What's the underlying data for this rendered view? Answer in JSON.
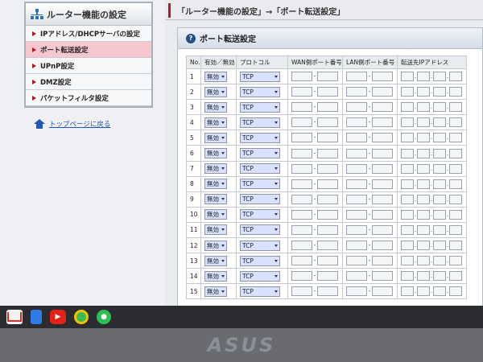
{
  "sidebar": {
    "title": "ルーター機能の設定",
    "items": [
      {
        "label": "IPアドレス/DHCPサーバの設定",
        "active": false
      },
      {
        "label": "ポート転送設定",
        "active": true
      },
      {
        "label": "UPnP設定",
        "active": false
      },
      {
        "label": "DMZ設定",
        "active": false
      },
      {
        "label": "パケットフィルタ設定",
        "active": false
      }
    ],
    "top_link": "トップページに戻る"
  },
  "breadcrumb": "「ルーター機能の設定」→「ポート転送設定」",
  "panel": {
    "title": "ポート転送設定",
    "help_icon": "?",
    "columns": [
      "No.",
      "有効／無効",
      "プロトコル",
      "WAN側ポート番号",
      "LAN側ポート番号",
      "転送先IPアドレス"
    ],
    "rows": [
      {
        "no": "1",
        "enabled": "無効",
        "protocol": "TCP"
      },
      {
        "no": "2",
        "enabled": "無効",
        "protocol": "TCP"
      },
      {
        "no": "3",
        "enabled": "無効",
        "protocol": "TCP"
      },
      {
        "no": "4",
        "enabled": "無効",
        "protocol": "TCP"
      },
      {
        "no": "5",
        "enabled": "無効",
        "protocol": "TCP"
      },
      {
        "no": "6",
        "enabled": "無効",
        "protocol": "TCP"
      },
      {
        "no": "7",
        "enabled": "無効",
        "protocol": "TCP"
      },
      {
        "no": "8",
        "enabled": "無効",
        "protocol": "TCP"
      },
      {
        "no": "9",
        "enabled": "無効",
        "protocol": "TCP"
      },
      {
        "no": "10",
        "enabled": "無効",
        "protocol": "TCP"
      },
      {
        "no": "11",
        "enabled": "無効",
        "protocol": "TCP"
      },
      {
        "no": "12",
        "enabled": "無効",
        "protocol": "TCP"
      },
      {
        "no": "13",
        "enabled": "無効",
        "protocol": "TCP"
      },
      {
        "no": "14",
        "enabled": "無効",
        "protocol": "TCP"
      },
      {
        "no": "15",
        "enabled": "無効",
        "protocol": "TCP"
      }
    ]
  },
  "taskbar": {
    "icons": [
      "gmail-icon",
      "docs-icon",
      "youtube-icon",
      "chrome-icon",
      "line-icon"
    ]
  },
  "bezel": {
    "logo": "ASUS"
  },
  "colors": {
    "accent": "#b01a2a",
    "active_item": "#f6c7cf",
    "link": "#1e57b8",
    "select_bg": "#d8e2ff"
  }
}
